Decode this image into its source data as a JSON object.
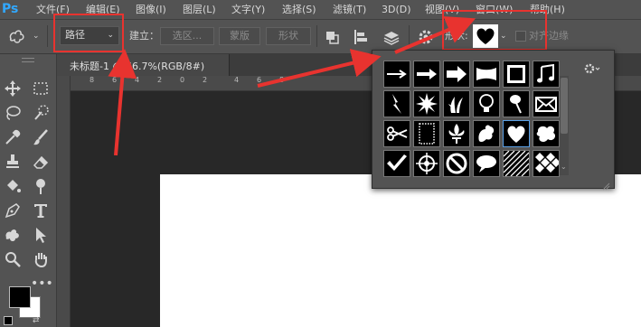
{
  "app": {
    "logo": "Ps"
  },
  "menus": [
    "文件(F)",
    "编辑(E)",
    "图像(I)",
    "图层(L)",
    "文字(Y)",
    "选择(S)",
    "滤镜(T)",
    "3D(D)",
    "视图(V)",
    "窗口(W)",
    "帮助(H)"
  ],
  "options": {
    "mode_value": "路径",
    "create_label": "建立：",
    "selection_btn": "选区...",
    "mask_btn": "蒙版",
    "shape_btn": "形状",
    "shape_label": "形状:",
    "align_edges_label": "对齐边缘"
  },
  "document": {
    "tab_title": "未标题-1 @ 66.7%(RGB/8#)"
  },
  "ruler": {
    "labels": [
      "8",
      "6",
      "4",
      "2",
      "0",
      "2",
      "4",
      "6",
      "8"
    ]
  },
  "shape_picker": {
    "shapes": [
      "arrow-thin-icon",
      "arrow-medium-icon",
      "arrow-bold-icon",
      "banner-icon",
      "frame-icon",
      "music-notes-icon",
      "lightning-icon",
      "starburst-icon",
      "grass-icon",
      "lightbulb-icon",
      "thumbtack-icon",
      "envelope-icon",
      "scissors-icon",
      "stamp-frame-icon",
      "fleur-de-lis-icon",
      "ornament-icon",
      "heart-icon",
      "blob-icon",
      "checkmark-icon",
      "target-icon",
      "no-sign-icon",
      "speech-bubble-icon",
      "diagonal-stripes-icon",
      "checker-icon"
    ],
    "selected": "heart-icon"
  },
  "colors": {
    "annotation": "#e8332f",
    "selection": "#5aa0e6"
  }
}
